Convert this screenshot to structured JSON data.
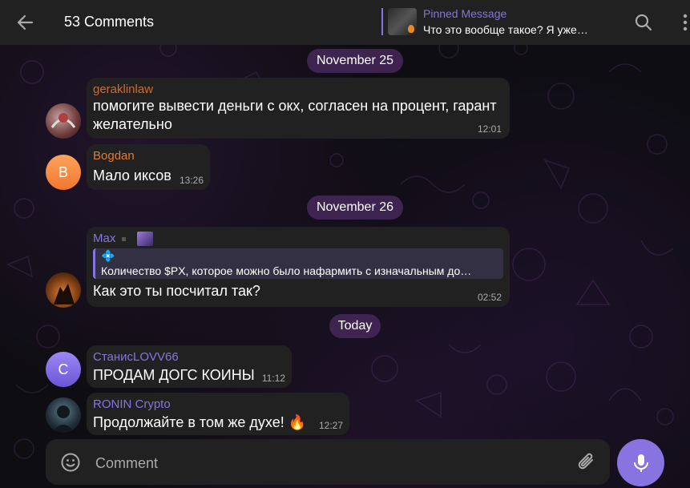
{
  "header": {
    "title": "53 Comments",
    "pinned_title": "Pinned Message",
    "pinned_text": "Что это вообще такое? Я уже…"
  },
  "dates": {
    "d1": "November 25",
    "d2": "November 26",
    "d3": "Today"
  },
  "messages": [
    {
      "author": "geraklinlaw",
      "author_color": "#d36a2f",
      "text_line1": "помогите вывести деньги с окх, согласен на процент, гарант",
      "text_line2": "желательно",
      "time": "12:01"
    },
    {
      "author": "Bogdan",
      "author_color": "#e57a2e",
      "avatar_letter": "B",
      "text": "Мало иксов",
      "time": "13:26"
    },
    {
      "author": "Max",
      "author_color": "#8774e1",
      "reply_icon": "💠",
      "reply_text": "Количество $PX, которое можно было нафармить с изначальным до…",
      "text": "Как это ты посчитал так?",
      "time": "02:52"
    },
    {
      "author": "СтанисLOVV66",
      "author_color": "#8774e1",
      "avatar_letter": "С",
      "text": "ПРОДАМ ДОГС КОИНЫ",
      "time": "11:12"
    },
    {
      "author": "RONIN Crypto",
      "author_color": "#8774e1",
      "text": "Продолжайте в том же духе! 🔥",
      "time": "12:27"
    }
  ],
  "composer": {
    "placeholder": "Comment"
  },
  "colors": {
    "accent": "#8774e1",
    "bubble": "#212121",
    "header": "#212121"
  }
}
